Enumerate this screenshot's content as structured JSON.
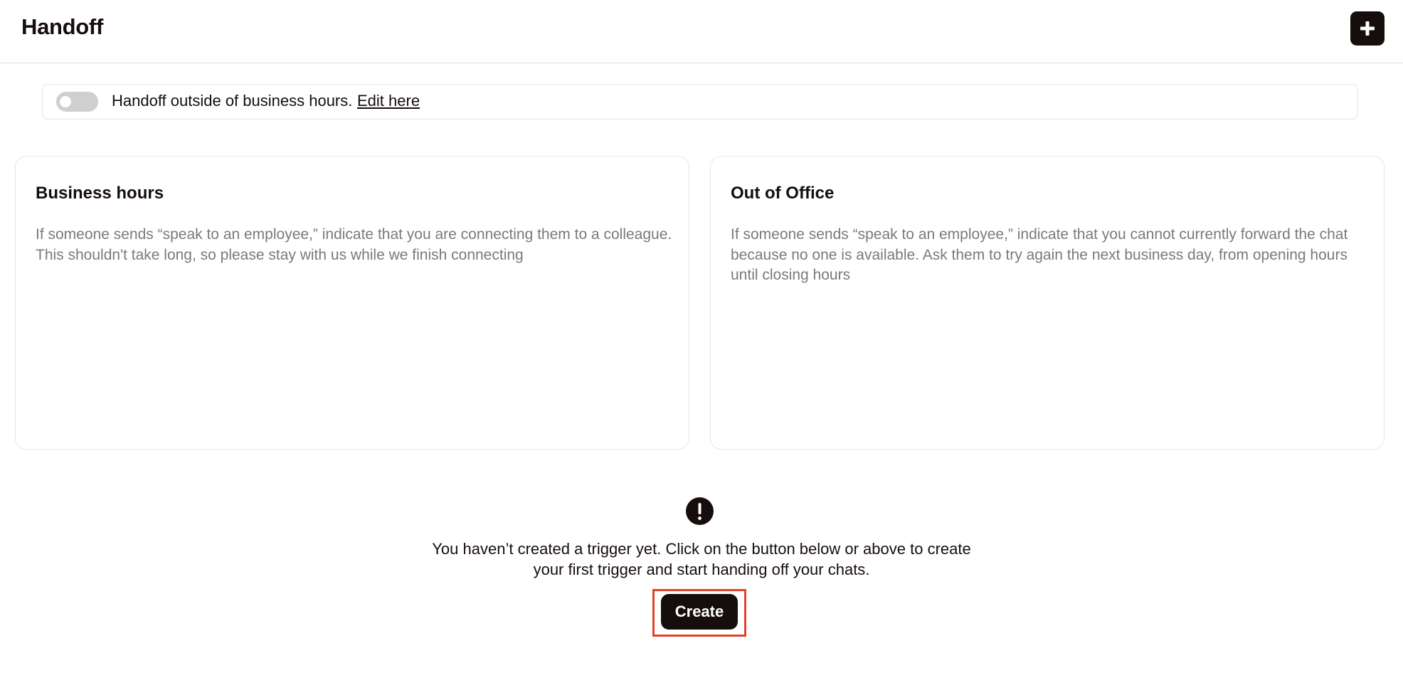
{
  "header": {
    "title": "Handoff",
    "add_icon": "plus-icon"
  },
  "toggle_bar": {
    "enabled": false,
    "text": "Handoff outside of business hours.",
    "link_label": "Edit here"
  },
  "cards": [
    {
      "title": "Business hours",
      "description": "If someone sends “speak to an employee,” indicate that you are connecting them to a colleague. This shouldn't take long, so please stay with us while we finish connecting"
    },
    {
      "title": "Out of Office",
      "description": "If someone sends “speak to an employee,” indicate that you cannot currently forward the chat because no one is available. Ask them to try again the next business day, from opening hours until closing hours"
    }
  ],
  "empty_state": {
    "icon": "exclamation-icon",
    "line1": "You haven’t created a trigger yet. Click on the button below or above to create",
    "line2": "your first trigger and start handing off your chats.",
    "button_label": "Create"
  },
  "colors": {
    "primary": "#160e0c",
    "muted_text": "#7a7a7a",
    "toggle_off": "#cfcfcf",
    "highlight": "#e0432b"
  }
}
